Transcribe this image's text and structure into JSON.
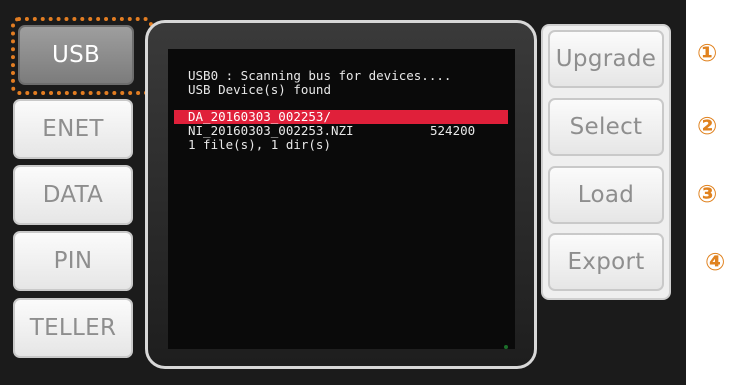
{
  "left_buttons": [
    {
      "label": "USB",
      "active": true
    },
    {
      "label": "ENET",
      "active": false
    },
    {
      "label": "DATA",
      "active": false
    },
    {
      "label": "PIN",
      "active": false
    },
    {
      "label": "TELLER",
      "active": false
    }
  ],
  "terminal": {
    "line1": "USB0 : Scanning bus for devices....",
    "line2": "USB Device(s) found",
    "selected_entry": "DA_20160303_002253/",
    "file_name": "NI_20160303_002253.NZI",
    "file_size": "524200",
    "summary": "1 file(s), 1 dir(s)"
  },
  "right_buttons": [
    {
      "label": "Upgrade"
    },
    {
      "label": "Select"
    },
    {
      "label": "Load"
    },
    {
      "label": "Export"
    }
  ],
  "step_numbers": [
    "①",
    "②",
    "③",
    "④"
  ],
  "colors": {
    "highlight": "#e27d22",
    "selection": "#e0203a",
    "panel": "#1b1b1b"
  }
}
